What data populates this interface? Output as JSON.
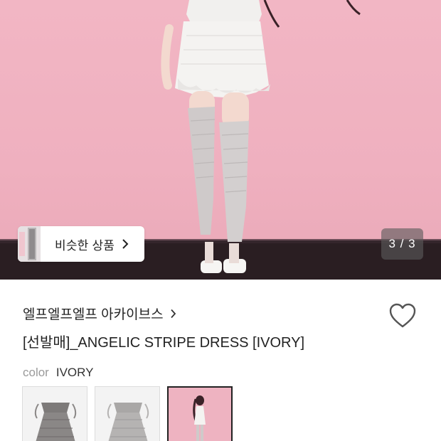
{
  "gallery": {
    "similar_label": "비슷한 상품",
    "counter": "3 / 3"
  },
  "product": {
    "brand": "엘프엘프엘프 아카이브스",
    "title": "[선발매]_ANGELIC STRIPE DRESS [IVORY]",
    "color_key": "color",
    "color_value": "IVORY"
  },
  "options": [
    {
      "name": "gray-dress"
    },
    {
      "name": "light-gray-dress"
    },
    {
      "name": "ivory-model-photo",
      "selected": true
    }
  ],
  "colors": {
    "background_pink": "#efb0bf",
    "floor": "#2a1e22",
    "text": "#222222",
    "muted": "#9a9a9a"
  }
}
